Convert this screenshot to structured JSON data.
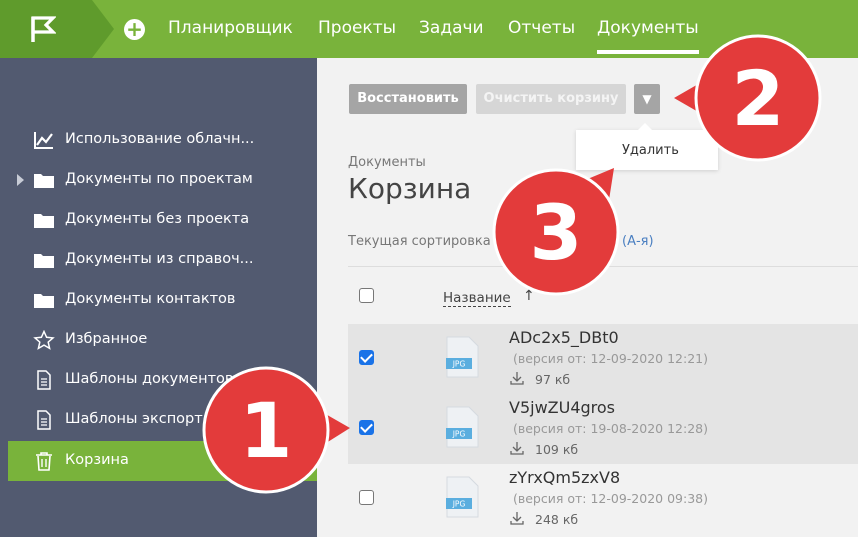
{
  "topnav": {
    "items": [
      "Планировщик",
      "Проекты",
      "Задачи",
      "Отчеты",
      "Документы"
    ],
    "active": "Документы"
  },
  "sidebar": {
    "items": [
      {
        "label": "Использование облачн...",
        "icon": "chart-line-icon"
      },
      {
        "label": "Документы по проектам",
        "icon": "folder-icon",
        "expandable": true
      },
      {
        "label": "Документы без проекта",
        "icon": "folder-icon"
      },
      {
        "label": "Документы из справоч...",
        "icon": "folder-icon"
      },
      {
        "label": "Документы контактов",
        "icon": "folder-icon"
      },
      {
        "label": "Избранное",
        "icon": "star-icon"
      },
      {
        "label": "Шаблоны документов",
        "icon": "document-icon"
      },
      {
        "label": "Шаблоны экспорта",
        "icon": "document-icon"
      },
      {
        "label": "Корзина",
        "icon": "trash-icon",
        "active": true
      }
    ]
  },
  "toolbar": {
    "restore_label": "Восстановить",
    "clear_label": "Очистить корзину",
    "dropdown_glyph": "▼",
    "dropdown_items": [
      "Удалить"
    ]
  },
  "page": {
    "breadcrumb": "Документы",
    "title": "Корзина",
    "sort_prefix": "Текущая сортировка",
    "sort_value": "(А-я)"
  },
  "table": {
    "header": {
      "name": "Название",
      "sort_arrow": "↑"
    },
    "rows": [
      {
        "name": "ADc2x5_DBt0",
        "version": "(версия от: 12-09-2020 12:21)",
        "size": "97 кб",
        "checked": true,
        "ext": "JPG"
      },
      {
        "name": "V5jwZU4gros",
        "version": "(версия от: 19-08-2020 12:28)",
        "size": "109 кб",
        "checked": true,
        "ext": "JPG"
      },
      {
        "name": "zYrxQm5zxV8",
        "version": "(версия от: 12-09-2020 09:38)",
        "size": "248 кб",
        "checked": false,
        "ext": "JPG"
      }
    ]
  },
  "callouts": [
    "1",
    "2",
    "3"
  ],
  "colors": {
    "brand_green": "#79b33b",
    "sidebar_bg": "#525a70",
    "callout_red": "#e33b3b"
  }
}
